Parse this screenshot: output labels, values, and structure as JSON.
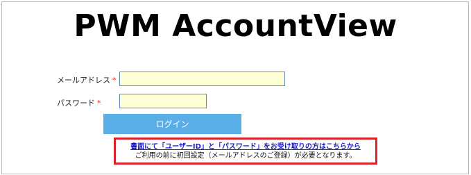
{
  "header": {
    "title": "PWM AccountView"
  },
  "form": {
    "email": {
      "label": "メールアドレス",
      "required_mark": "*",
      "value": "",
      "placeholder": ""
    },
    "password": {
      "label": "パスワード",
      "required_mark": "*",
      "value": "",
      "placeholder": ""
    },
    "login_label": "ログイン"
  },
  "notice": {
    "link_text": "書面にて「ユーザーID」と「パスワード」をお受け取りの方はこちらから",
    "sub_text": "ご利用の前に初回設定（メールアドレスのご登録）が必要となります。"
  },
  "colors": {
    "button": "#5aaee8",
    "field_bg": "#ffffd6",
    "notice_border": "#d8232a",
    "link": "#1b1bd1",
    "required": "#e02020"
  }
}
